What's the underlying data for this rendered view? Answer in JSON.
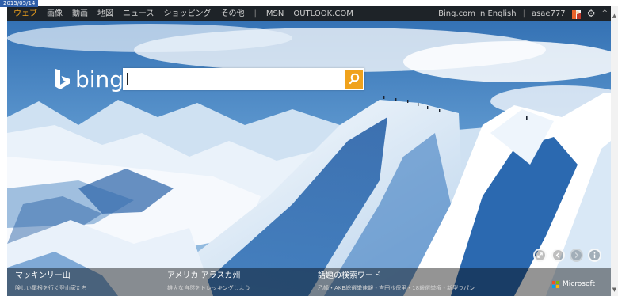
{
  "date_badge": "2015/05/14",
  "nav": {
    "items": [
      "ウェブ",
      "画像",
      "動画",
      "地図",
      "ニュース",
      "ショッピング",
      "その他"
    ],
    "separator": "|",
    "extra": [
      "MSN",
      "OUTLOOK.COM"
    ],
    "active_index": 0
  },
  "account": {
    "english_link": "Bing.com in English",
    "separator": "|",
    "username": "asae777",
    "settings_icon": "gear-icon",
    "collapse_icon": "chevron-up-icon"
  },
  "logo": {
    "wordmark": "bing"
  },
  "search": {
    "value": "",
    "placeholder": "",
    "button_icon": "search-icon"
  },
  "controls": [
    "expand-icon",
    "previous-icon",
    "next-icon",
    "info-icon"
  ],
  "info_items": [
    {
      "title": "マッキンリー山",
      "subtitle": "険しい尾根を行く登山家たち"
    },
    {
      "title": "アメリカ アラスカ州",
      "subtitle": "雄大な自然をトレッキングしよう"
    },
    {
      "title": "話題の検索ワード",
      "subtitle": "乙幡・AKB総選挙速報・吉田沙保里・18歳選挙権・新型ラパン"
    }
  ],
  "brand": {
    "label": "Microsoft"
  },
  "colors": {
    "accent": "#f0a21c",
    "topbar": "#1c1c1c",
    "sky": "#3a78b8",
    "ms_red": "#f25022",
    "ms_green": "#7fba00",
    "ms_blue": "#00a4ef",
    "ms_yellow": "#ffb900"
  }
}
